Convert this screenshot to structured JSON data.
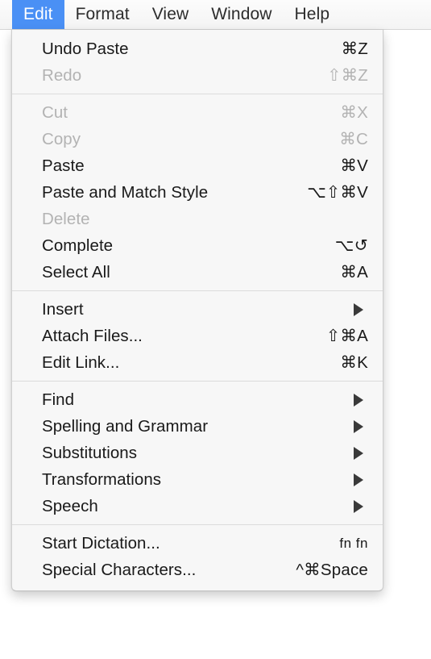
{
  "menubar": {
    "items": [
      {
        "label": "Edit",
        "active": true
      },
      {
        "label": "Format",
        "active": false
      },
      {
        "label": "View",
        "active": false
      },
      {
        "label": "Window",
        "active": false
      },
      {
        "label": "Help",
        "active": false
      }
    ],
    "highlight_color": "#4a90f5",
    "background_color": "#f6f6f6"
  },
  "edit_menu": {
    "title": "Edit",
    "background_color": "#f7f7f7",
    "enabled_text_color": "#191919",
    "disabled_text_color": "#b3b3b3",
    "sections": [
      {
        "items": [
          {
            "label": "Undo Paste",
            "shortcut": "⌘Z",
            "enabled": true,
            "submenu": false
          },
          {
            "label": "Redo",
            "shortcut": "⇧⌘Z",
            "enabled": false,
            "submenu": false
          }
        ]
      },
      {
        "items": [
          {
            "label": "Cut",
            "shortcut": "⌘X",
            "enabled": false,
            "submenu": false
          },
          {
            "label": "Copy",
            "shortcut": "⌘C",
            "enabled": false,
            "submenu": false
          },
          {
            "label": "Paste",
            "shortcut": "⌘V",
            "enabled": true,
            "submenu": false
          },
          {
            "label": "Paste and Match Style",
            "shortcut": "⌥⇧⌘V",
            "enabled": true,
            "submenu": false
          },
          {
            "label": "Delete",
            "shortcut": "",
            "enabled": false,
            "submenu": false
          },
          {
            "label": "Complete",
            "shortcut": "⌥↺",
            "enabled": true,
            "submenu": false
          },
          {
            "label": "Select All",
            "shortcut": "⌘A",
            "enabled": true,
            "submenu": false
          }
        ]
      },
      {
        "items": [
          {
            "label": "Insert",
            "shortcut": "",
            "enabled": true,
            "submenu": true
          },
          {
            "label": "Attach Files...",
            "shortcut": "⇧⌘A",
            "enabled": true,
            "submenu": false
          },
          {
            "label": "Edit Link...",
            "shortcut": "⌘K",
            "enabled": true,
            "submenu": false
          }
        ]
      },
      {
        "items": [
          {
            "label": "Find",
            "shortcut": "",
            "enabled": true,
            "submenu": true
          },
          {
            "label": "Spelling and Grammar",
            "shortcut": "",
            "enabled": true,
            "submenu": true
          },
          {
            "label": "Substitutions",
            "shortcut": "",
            "enabled": true,
            "submenu": true
          },
          {
            "label": "Transformations",
            "shortcut": "",
            "enabled": true,
            "submenu": true
          },
          {
            "label": "Speech",
            "shortcut": "",
            "enabled": true,
            "submenu": true
          }
        ]
      },
      {
        "items": [
          {
            "label": "Start Dictation...",
            "shortcut": "fn fn",
            "enabled": true,
            "submenu": false,
            "shortcut_small": true
          },
          {
            "label": "Special Characters...",
            "shortcut": "^⌘Space",
            "enabled": true,
            "submenu": false
          }
        ]
      }
    ]
  }
}
